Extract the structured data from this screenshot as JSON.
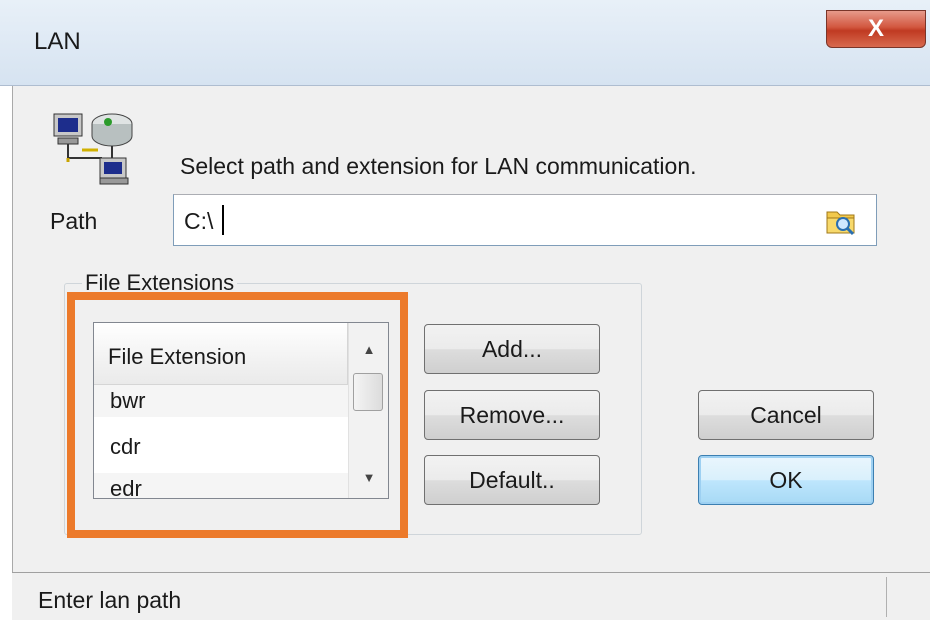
{
  "window": {
    "title": "LAN",
    "close_glyph": "X"
  },
  "instruction": "Select path and extension for LAN communication.",
  "path": {
    "label": "Path",
    "value": "C:\\"
  },
  "file_extensions": {
    "group_label": "File Extensions",
    "column_header": "File Extension",
    "items": [
      "bwr",
      "cdr",
      "edr"
    ]
  },
  "buttons": {
    "add": "Add...",
    "remove": "Remove...",
    "default": "Default..",
    "cancel": "Cancel",
    "ok": "OK"
  },
  "status": {
    "text": "Enter lan path"
  },
  "icons": {
    "network": "network-computers-icon",
    "browse": "folder-browse-icon",
    "scroll_up": "scroll-up-arrow-icon",
    "scroll_down": "scroll-down-arrow-icon"
  },
  "colors": {
    "highlight": "#ec7a2b",
    "close_button": "#c9452c",
    "default_button": "#3c7fb1"
  }
}
